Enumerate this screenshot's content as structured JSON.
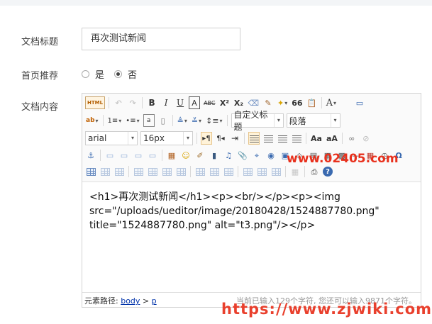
{
  "form": {
    "title_label": "文档标题",
    "title_value": "再次测试新闻",
    "recommend_label": "首页推荐",
    "recommend_options": [
      "是",
      "否"
    ],
    "recommend_selected": "否",
    "content_label": "文档内容"
  },
  "toolbar": {
    "html_label": "HTML",
    "format_select": "自定义标题",
    "paragraph_select": "段落",
    "font_select": "arial",
    "size_select": "16px",
    "glyphs": {
      "undo": "↶",
      "redo": "↷",
      "bold": "B",
      "italic": "I",
      "underline": "U",
      "fontborder": "A",
      "strike": "ABC",
      "sup": "X²",
      "sub": "X₂",
      "eraser": "⌫",
      "brush": "✎",
      "autotype": "✦",
      "quote": "66",
      "paste": "📋",
      "forecolor": "A",
      "preview": "▭",
      "backcolor": "ab",
      "ol": "1≡",
      "ul": "•≡",
      "selectall": "a",
      "cleardoc": "▯",
      "rowspace_top": "≜",
      "rowspace_bottom": "≚",
      "lineheight": "↕≡",
      "ltr": "▸¶",
      "rtl": "¶◂",
      "indent": "⇥",
      "justify_left": "≡",
      "justify_center": "≡",
      "justify_right": "≡",
      "justify_full": "≡",
      "touppercase": "Aa",
      "tolowercase": "aA",
      "link": "∞",
      "unlink": "⊘",
      "anchor": "⚓",
      "image_none": "▭",
      "image_left": "▭",
      "image_right": "▭",
      "image_center": "▭",
      "simpleupload": "▦",
      "emotion": "☺",
      "scrawl": "✐",
      "video": "▮",
      "music": "♫",
      "attachment": "📎",
      "map": "⌖",
      "gmap": "◉",
      "insertframe": "▣",
      "code": "◇",
      "pagebreak": "▤",
      "template": "▦",
      "background": "▩",
      "horizontal": "—",
      "date": "▦",
      "time": "◷",
      "spechars": "Ω",
      "wordimage": "▦",
      "print": "⎙",
      "help": "?",
      "snapscreen": "▣",
      "searchreplace": "⌕",
      "drafts": "✉",
      "fullscreen": "▭"
    }
  },
  "editor": {
    "content_line1": "<h1>再次测试新闻</h1><p><br/></p><p><img",
    "content_line2": "src=\"/uploads/ueditor/image/20180428/1524887780.png\"",
    "content_line3": "title=\"1524887780.png\" alt=\"t3.png\"/></p>",
    "path_label": "元素路径:",
    "path_body": "body",
    "path_sep": ">",
    "path_p": "p",
    "word_count": "当前已输入129个字符, 您还可以输入9871个字符。"
  },
  "watermarks": {
    "top": "www.02405.com",
    "bottom": "https://www.zjwiki.com"
  },
  "colors": {
    "watermark": "#e8301c",
    "link": "#0033aa",
    "active_button_bg": "#fff3d9"
  }
}
